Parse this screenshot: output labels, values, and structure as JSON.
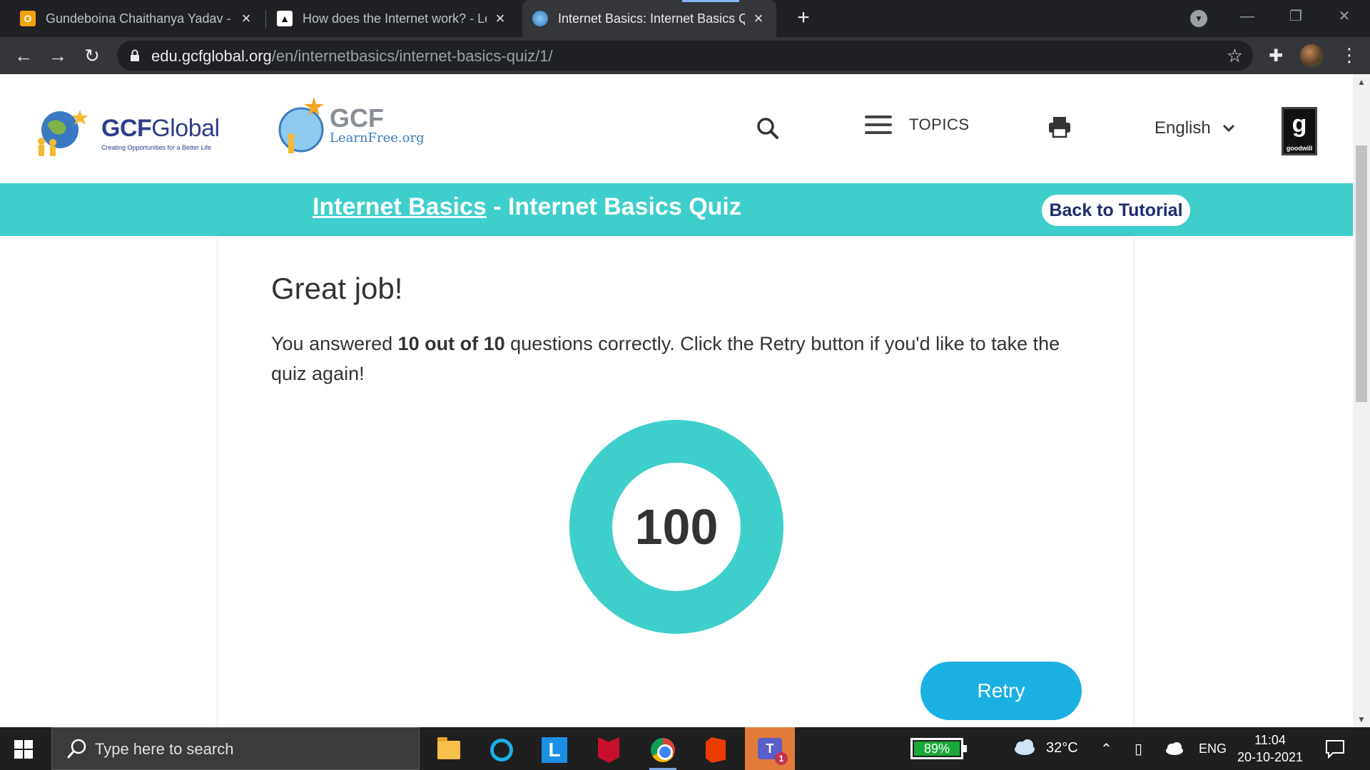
{
  "browser": {
    "tabs": [
      {
        "title": "Gundeboina Chaithanya Yadav - ",
        "favicon": "outlook-icon"
      },
      {
        "title": "How does the Internet work? - Le",
        "favicon": "graduation-cap-icon"
      },
      {
        "title": "Internet Basics: Internet Basics Qu",
        "favicon": "gcf-globe-icon",
        "active": true
      }
    ],
    "url_domain": "edu.gcfglobal.org",
    "url_path": "/en/internetbasics/internet-basics-quiz/1/"
  },
  "header": {
    "logo_word_bold": "GCF",
    "logo_word_regular": "Global",
    "logo_tagline": "Creating Opportunities for a Better Life",
    "learnfree_gcf": "GCF",
    "learnfree_org": "LearnFree.org",
    "topics_label": "TOPICS",
    "language": "English",
    "goodwill_label": "goodwill"
  },
  "banner": {
    "course_link": "Internet Basics",
    "separator": " - ",
    "quiz_title": "Internet Basics Quiz",
    "back_button": "Back to Tutorial"
  },
  "result": {
    "heading": "Great job!",
    "text_before": "You answered ",
    "score_text": "10 out of 10",
    "text_after": " questions correctly. Click the Retry button if you'd like to take the quiz again!",
    "score_value": "100",
    "retry_label": "Retry"
  },
  "taskbar": {
    "search_placeholder": "Type here to search",
    "battery": "89%",
    "temperature": "32°C",
    "language": "ENG",
    "time": "11:04",
    "date": "20-10-2021"
  },
  "colors": {
    "teal": "#3ecfcc",
    "retry_blue": "#1ab1e2",
    "navy": "#2e3d8b"
  }
}
